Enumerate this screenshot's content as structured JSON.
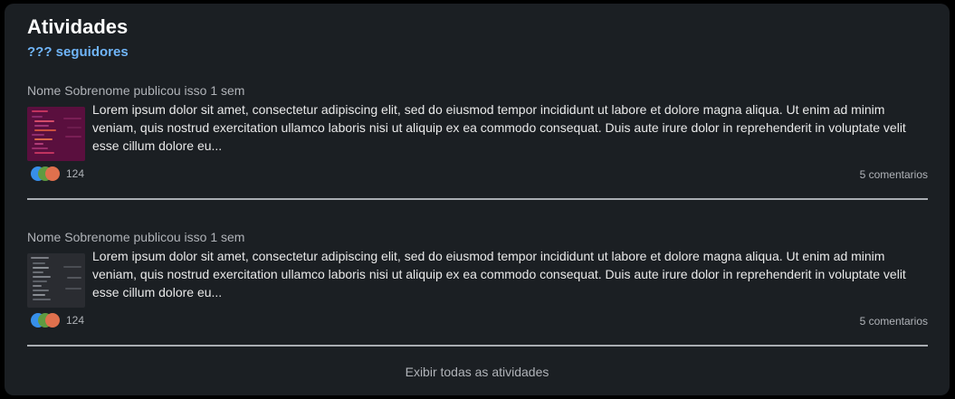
{
  "section": {
    "title": "Atividades",
    "followers": "??? seguidores",
    "show_all_label": "Exibir todas as atividades"
  },
  "posts": [
    {
      "header": "Nome Sobrenome publicou isso 1 sem",
      "text": "Lorem ipsum dolor sit amet, consectetur adipiscing elit, sed do eiusmod tempor incididunt ut labore et dolore magna aliqua. Ut enim ad minim veniam, quis nostrud exercitation ullamco laboris nisi ut aliquip ex ea commodo consequat. Duis aute irure dolor in reprehenderit in voluptate velit esse cillum dolore eu...",
      "reaction_count": "124",
      "comments_label": "5 comentarios",
      "thumbnail_bg": "#5a0f3e"
    },
    {
      "header": "Nome Sobrenome publicou isso 1 sem",
      "text": "Lorem ipsum dolor sit amet, consectetur adipiscing elit, sed do eiusmod tempor incididunt ut labore et dolore magna aliqua. Ut enim ad minim veniam, quis nostrud exercitation ullamco laboris nisi ut aliquip ex ea commodo consequat. Duis aute irure dolor in reprehenderit in voluptate velit esse cillum dolore eu...",
      "reaction_count": "124",
      "comments_label": "5 comentarios",
      "thumbnail_bg": "#2a2c31"
    }
  ],
  "colors": {
    "background": "#1b1f23",
    "accent": "#70b5f9",
    "reaction_like": "#378fe9",
    "reaction_celebrate": "#5f9b41",
    "reaction_love": "#df704d"
  },
  "icons": {
    "reactions": [
      "like-icon",
      "celebrate-icon",
      "love-icon"
    ]
  }
}
